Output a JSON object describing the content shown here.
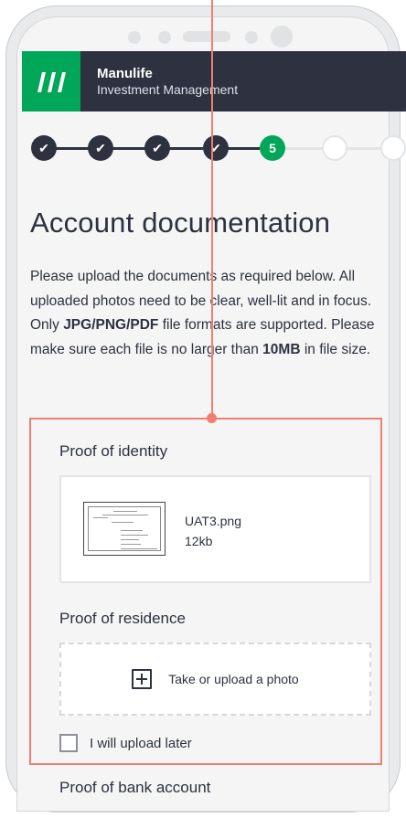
{
  "header": {
    "brand_name": "Manulife",
    "brand_sub": "Investment Management",
    "logo_icon": "manulife-logo",
    "brand_color": "#00a758",
    "header_bg": "#2d3140"
  },
  "stepper": {
    "current_step": "5",
    "completed_steps": 4,
    "total_visible_steps": 7
  },
  "page": {
    "title": "Account documentation",
    "intro_part1": "Please upload the documents as required below. All uploaded photos need to be clear, well-lit and in focus. Only ",
    "intro_formats": "JPG/PNG/PDF",
    "intro_part2": " file formats are supported. Please make sure each file is no larger than ",
    "intro_size": "10MB",
    "intro_part3": " in file size."
  },
  "sections": {
    "identity": {
      "title": "Proof of identity",
      "file_name": "UAT3.png",
      "file_size": "12kb"
    },
    "residence": {
      "title": "Proof of residence",
      "upload_label": "Take or upload a photo",
      "upload_later_label": "I will upload later"
    },
    "bank": {
      "title": "Proof of bank account"
    }
  },
  "highlight_color": "#f07f72"
}
